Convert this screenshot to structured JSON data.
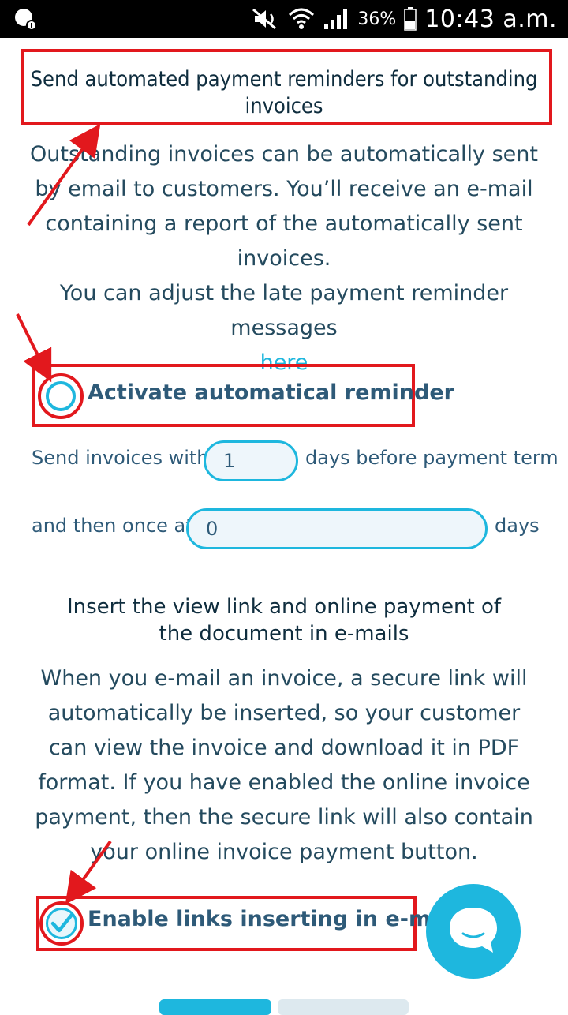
{
  "status_bar": {
    "battery": "36%",
    "time": "10:43 a.m."
  },
  "reminders": {
    "title": "Send automated payment reminders for outstanding invoices",
    "description": "Outstanding invoices can be automatically sent by email to customers. You’ll receive an e-mail containing a report of the automatically sent invoices.",
    "adjust_text": "You can adjust the late payment reminder messages",
    "here_link": "here",
    "activate_label": "Activate automatical reminder",
    "activate_checked": false,
    "send_with_label": "Send invoices with",
    "days_before_value": "1",
    "days_before_suffix": "days before payment term",
    "then_once_label": "and then once at",
    "then_once_value": "0",
    "then_once_suffix": "days"
  },
  "links": {
    "title": "Insert the view link and online payment of the document in e-mails",
    "description": "When you e-mail an invoice, a secure link will automatically be inserted, so your customer can view the invoice and download it in PDF format. If you have enabled the online invoice payment, then the secure link will also contain your online invoice payment button.",
    "enable_label": "Enable links inserting in e-mails",
    "enable_checked": true
  },
  "colors": {
    "accent": "#1eb7de",
    "annotation": "#e2181d",
    "text_dark": "#0f2d3e",
    "text_label": "#2e5a78"
  },
  "icons": [
    "status-notification-icon",
    "mute-icon",
    "wifi-icon",
    "signal-icon",
    "battery-icon",
    "chat-icon",
    "checkmark-icon"
  ]
}
